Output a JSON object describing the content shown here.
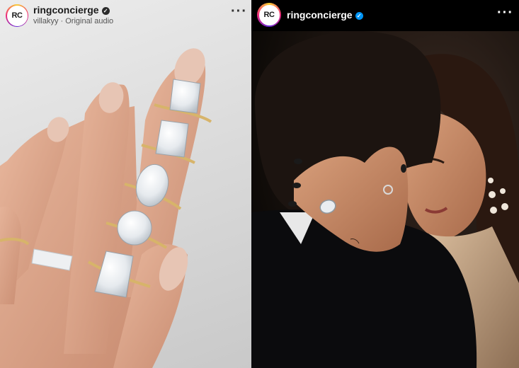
{
  "left_post": {
    "avatar_initials": "RC",
    "username": "ringconcierge",
    "audio_user": "villakyy",
    "audio_separator": "·",
    "audio_label": "Original audio",
    "more_icon": "ellipsis-icon"
  },
  "right_post": {
    "avatar_initials": "RC",
    "username": "ringconcierge",
    "more_icon": "ellipsis-icon"
  },
  "colors": {
    "verified_light": "#2b2b2b",
    "verified_blue": "#0095f6",
    "gold": "#d7b46a",
    "nail": "#e7c5b4"
  }
}
